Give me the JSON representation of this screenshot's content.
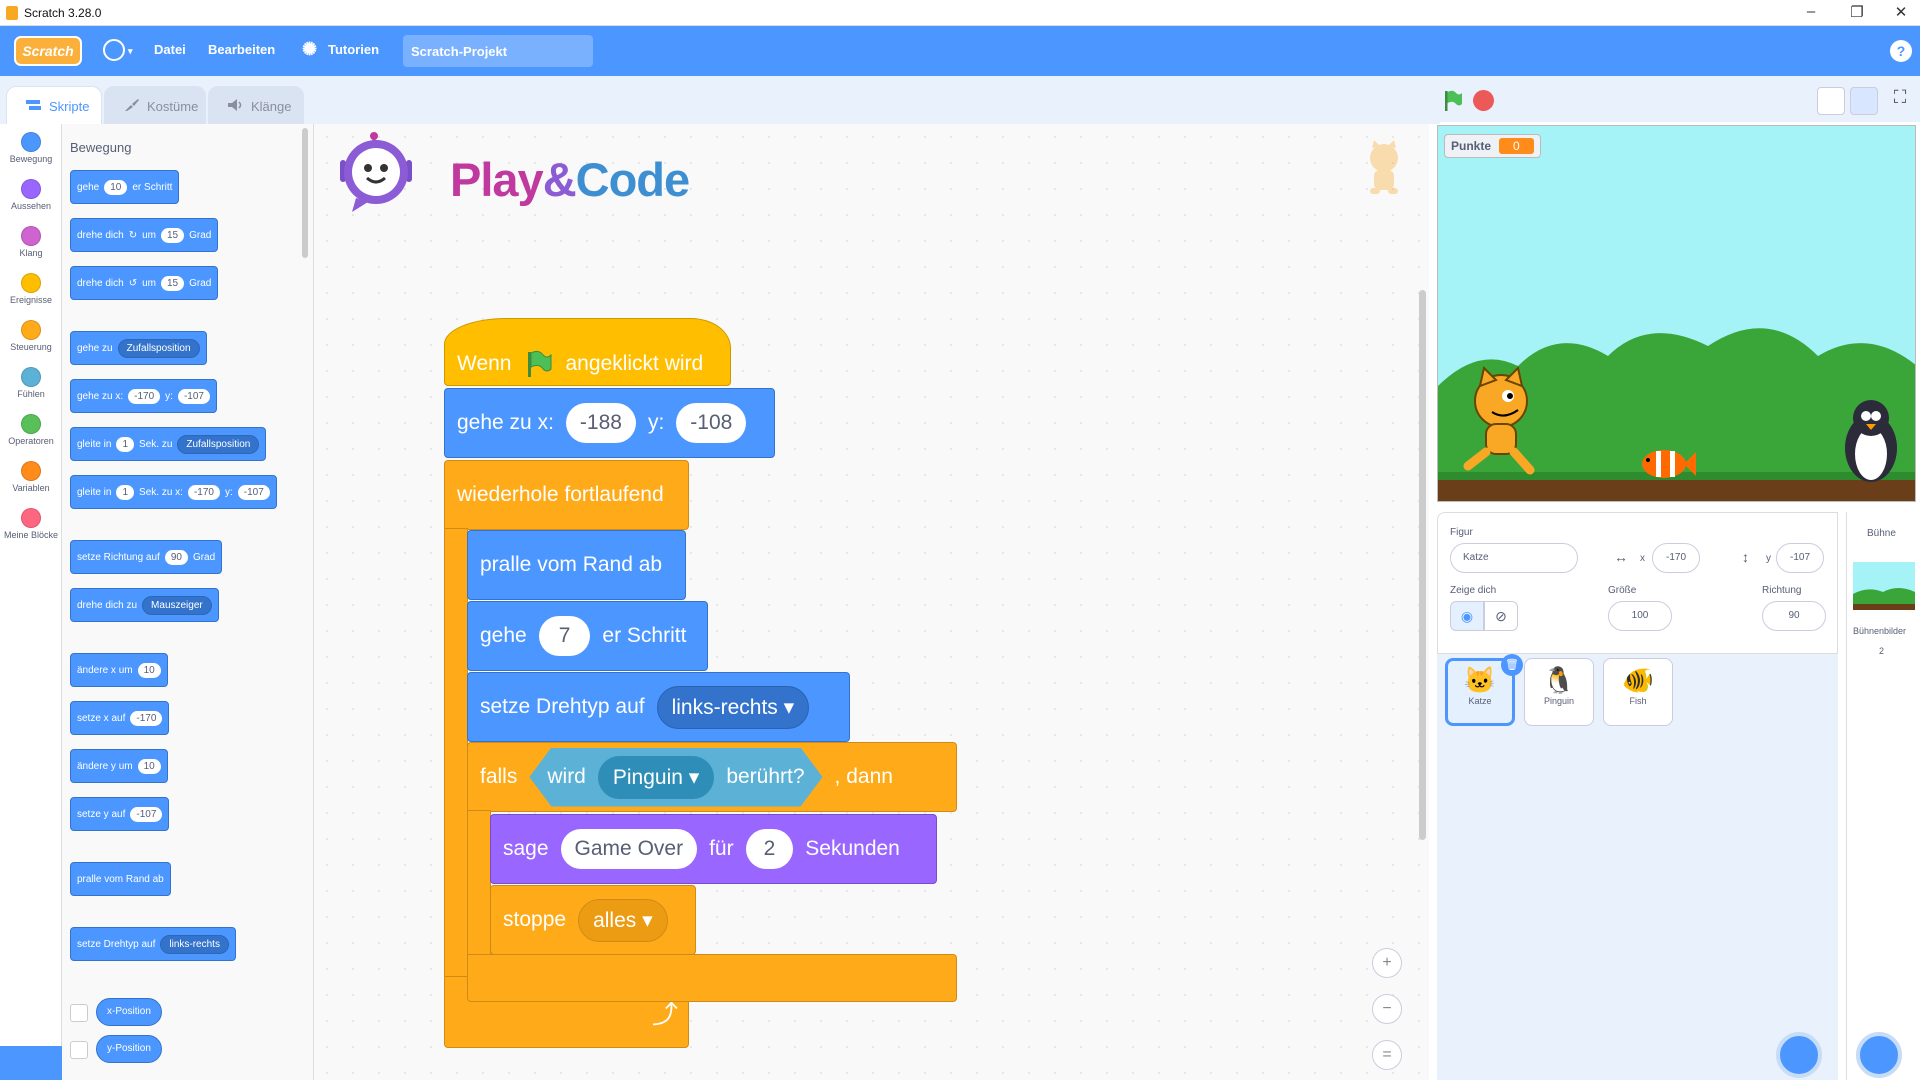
{
  "titlebar": {
    "title": "Scratch 3.28.0",
    "minimize": "–",
    "restore": "❐",
    "close": "✕"
  },
  "menu": {
    "logo": "Scratch",
    "file": "Datei",
    "edit": "Bearbeiten",
    "tutorials": "Tutorien",
    "project_name": "Scratch-Projekt",
    "help": "?"
  },
  "tabs": {
    "code": "Skripte",
    "costumes": "Kostüme",
    "sounds": "Klänge"
  },
  "categories": [
    {
      "label": "Bewegung",
      "color": "#4c97ff"
    },
    {
      "label": "Aussehen",
      "color": "#9966ff"
    },
    {
      "label": "Klang",
      "color": "#cf63cf"
    },
    {
      "label": "Ereignisse",
      "color": "#ffbf00"
    },
    {
      "label": "Steuerung",
      "color": "#ffab19"
    },
    {
      "label": "Fühlen",
      "color": "#5cb1d6"
    },
    {
      "label": "Operatoren",
      "color": "#59c059"
    },
    {
      "label": "Variablen",
      "color": "#ff8c1a"
    },
    {
      "label": "Meine Blöcke",
      "color": "#ff6680"
    }
  ],
  "palette": {
    "heading": "Bewegung",
    "move": {
      "a": "gehe",
      "v": "10",
      "b": "er Schritt"
    },
    "turn_right": {
      "a": "drehe dich",
      "b": "um",
      "v": "15",
      "c": "Grad"
    },
    "turn_left": {
      "a": "drehe dich",
      "b": "um",
      "v": "15",
      "c": "Grad"
    },
    "goto": {
      "a": "gehe zu",
      "v": "Zufallsposition"
    },
    "goto_xy": {
      "a": "gehe zu x:",
      "x": "-170",
      "b": "y:",
      "y": "-107"
    },
    "glide": {
      "a": "gleite in",
      "v": "1",
      "b": "Sek. zu",
      "t": "Zufallsposition"
    },
    "glide_xy": {
      "a": "gleite in",
      "v": "1",
      "b": "Sek. zu x:",
      "x": "-170",
      "c": "y:",
      "y": "-107"
    },
    "point_dir": {
      "a": "setze Richtung auf",
      "v": "90",
      "b": "Grad"
    },
    "point_towards": {
      "a": "drehe dich zu",
      "v": "Mauszeiger"
    },
    "change_x": {
      "a": "ändere x um",
      "v": "10"
    },
    "set_x": {
      "a": "setze x auf",
      "v": "-170"
    },
    "change_y": {
      "a": "ändere y um",
      "v": "10"
    },
    "set_y": {
      "a": "setze y auf",
      "v": "-107"
    },
    "bounce": {
      "a": "pralle vom Rand ab"
    },
    "rot_style": {
      "a": "setze Drehtyp auf",
      "v": "links-rechts"
    },
    "xpos": "x-Position",
    "ypos": "y-Position"
  },
  "logo_text": {
    "play": "Play",
    "amp": "&",
    "code": "Code"
  },
  "script": {
    "hat": {
      "a": "Wenn",
      "b": "angeklickt wird"
    },
    "goto": {
      "a": "gehe zu x:",
      "x": "-188",
      "b": "y:",
      "y": "-108"
    },
    "forever": "wiederhole fortlaufend",
    "bounce": "pralle vom Rand ab",
    "move": {
      "a": "gehe",
      "v": "7",
      "b": "er Schritt"
    },
    "rot": {
      "a": "setze Drehtyp auf",
      "v": "links-rechts"
    },
    "if": {
      "a": "falls",
      "b": ", dann",
      "touch_a": "wird",
      "touch_v": "Pinguin",
      "touch_b": "berührt?"
    },
    "say": {
      "a": "sage",
      "v": "Game Over",
      "b": "für",
      "n": "2",
      "c": "Sekunden"
    },
    "stop": {
      "a": "stoppe",
      "v": "alles"
    }
  },
  "zoom": {
    "in": "+",
    "out": "−",
    "reset": "="
  },
  "stage": {
    "monitor_label": "Punkte",
    "monitor_value": "0"
  },
  "sprite_info": {
    "sprite_label": "Figur",
    "sprite_name": "Katze",
    "x_label": "x",
    "x": "-170",
    "y_label": "y",
    "y": "-107",
    "show_label": "Zeige dich",
    "size_label": "Größe",
    "size": "100",
    "dir_label": "Richtung",
    "dir": "90"
  },
  "sprites": [
    {
      "name": "Katze"
    },
    {
      "name": "Pinguin"
    },
    {
      "name": "Fish"
    }
  ],
  "stage_pane": {
    "title": "Bühne",
    "backdrops_label": "Bühnenbilder",
    "backdrops_count": "2"
  }
}
